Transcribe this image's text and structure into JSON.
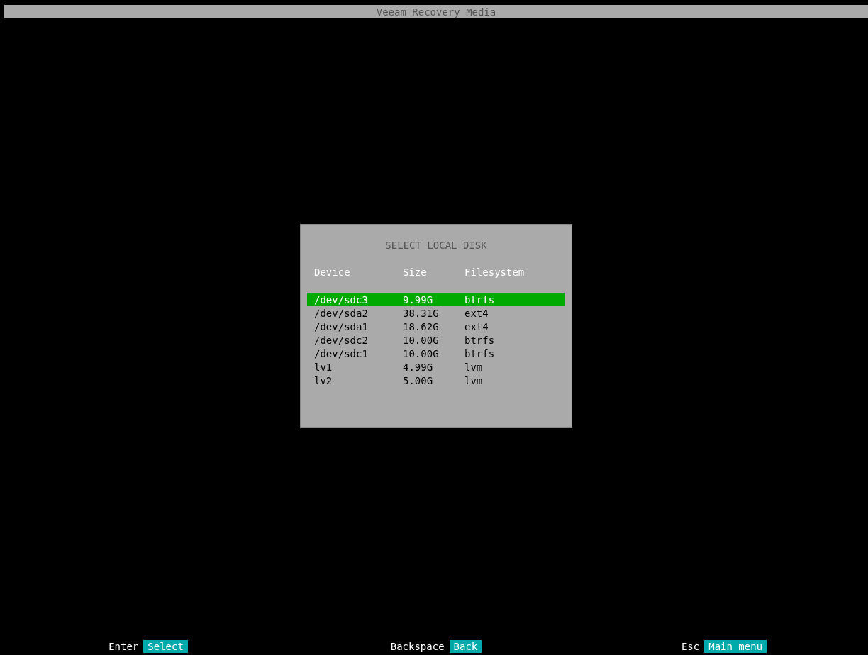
{
  "window": {
    "title": "Veeam Recovery Media"
  },
  "dialog": {
    "title": "SELECT LOCAL DISK",
    "columns": [
      "Device",
      "Size",
      "Filesystem"
    ],
    "rows": [
      {
        "device": "/dev/sdc3",
        "size": "9.99G",
        "filesystem": "btrfs",
        "selected": true
      },
      {
        "device": "/dev/sda2",
        "size": "38.31G",
        "filesystem": "ext4",
        "selected": false
      },
      {
        "device": "/dev/sda1",
        "size": "18.62G",
        "filesystem": "ext4",
        "selected": false
      },
      {
        "device": "/dev/sdc2",
        "size": "10.00G",
        "filesystem": "btrfs",
        "selected": false
      },
      {
        "device": "/dev/sdc1",
        "size": "10.00G",
        "filesystem": "btrfs",
        "selected": false
      },
      {
        "device": "lv1",
        "size": "4.99G",
        "filesystem": "lvm",
        "selected": false
      },
      {
        "device": "lv2",
        "size": "5.00G",
        "filesystem": "lvm",
        "selected": false
      }
    ]
  },
  "footer": [
    {
      "key": "Enter",
      "action": "Select"
    },
    {
      "key": "Backspace",
      "action": "Back"
    },
    {
      "key": "Esc",
      "action": "Main menu"
    }
  ]
}
